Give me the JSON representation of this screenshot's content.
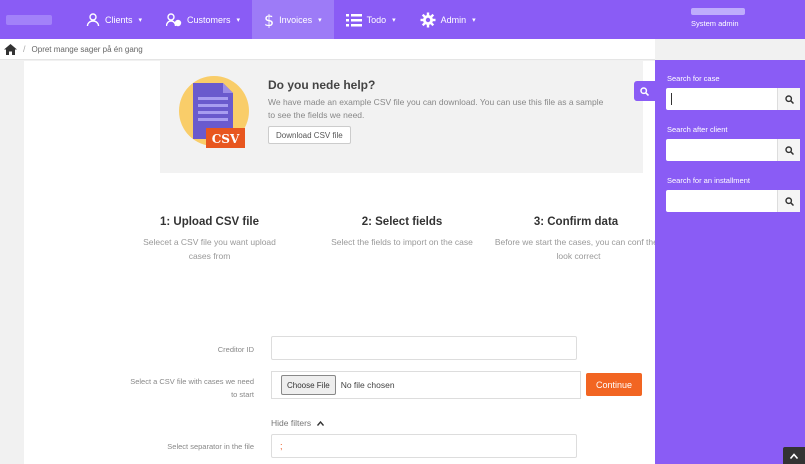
{
  "nav": {
    "items": [
      {
        "label": "Clients",
        "icon": "users-icon"
      },
      {
        "label": "Customers",
        "icon": "customers-icon"
      },
      {
        "label": "Invoices",
        "icon": "dollar-icon"
      },
      {
        "label": "Todo",
        "icon": "list-icon"
      },
      {
        "label": "Admin",
        "icon": "gear-icon"
      }
    ],
    "user_role": "System admin"
  },
  "breadcrumb": {
    "separator": "/",
    "current": "Opret mange sager på én gang"
  },
  "help": {
    "title": "Do you nede help?",
    "text": "We have made an example CSV file you can download. You can use this file as a sample to see the fields we need.",
    "download_label": "Download CSV file",
    "badge": "CSV"
  },
  "steps": [
    {
      "title": "1: Upload CSV file",
      "desc": "Selecet a CSV file you want upload cases from"
    },
    {
      "title": "2: Select fields",
      "desc": "Select the fields to import on the case"
    },
    {
      "title": "3: Confirm data",
      "desc": "Before we start the cases, you can conf they look correct"
    }
  ],
  "form": {
    "creditor_label": "Creditor ID",
    "creditor_value": "",
    "file_label": "Select a CSV file with cases we need to start",
    "choose_label": "Choose File",
    "no_file": "No file chosen",
    "continue_label": "Continue",
    "hide_filters": "Hide filters",
    "separator_label": "Select separator in the file",
    "separator_value": ";"
  },
  "sidebar": {
    "search_case": "Search for case",
    "search_client": "Search after client",
    "search_installment": "Search for an installment"
  },
  "colors": {
    "accent": "#8a5cf5",
    "continue": "#f26522"
  }
}
